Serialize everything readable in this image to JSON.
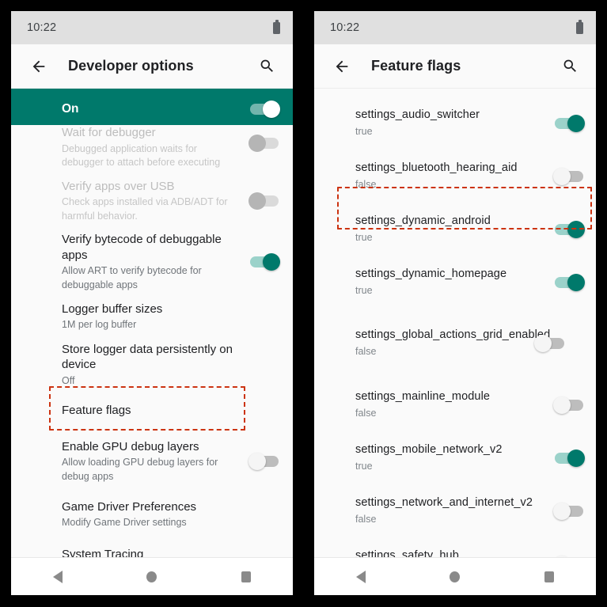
{
  "theme": {
    "teal": "#00796B",
    "highlight_red": "#CC3311",
    "status_bar_bg": "#E0E0E0",
    "app_bar_bg": "#FAFAFA",
    "page_bg": "#000000"
  },
  "left_phone": {
    "status_bar": {
      "time": "10:22",
      "battery_icon": "battery-icon"
    },
    "app_bar": {
      "back_icon": "arrow-back-icon",
      "title": "Developer options",
      "search_icon": "search-icon"
    },
    "master_switch": {
      "label": "On",
      "state": "on"
    },
    "rows": [
      {
        "title": "Wait for debugger",
        "subtitle": "Debugged application waits for debugger to attach before executing",
        "switch": "off",
        "dim": true
      },
      {
        "title": "Verify apps over USB",
        "subtitle": "Check apps installed via ADB/ADT for harmful behavior.",
        "switch": "off",
        "dim": true
      },
      {
        "title": "Verify bytecode of debuggable apps",
        "subtitle": "Allow ART to verify bytecode for debuggable apps",
        "switch": "on",
        "dim": false
      },
      {
        "title": "Logger buffer sizes",
        "subtitle": "1M per log buffer",
        "switch": "none",
        "dim": false
      },
      {
        "title": "Store logger data persistently on device",
        "subtitle": "Off",
        "switch": "none",
        "dim": false
      },
      {
        "title": "Feature flags",
        "subtitle": "",
        "switch": "none",
        "dim": false,
        "highlighted": true
      },
      {
        "title": "Enable GPU debug layers",
        "subtitle": "Allow loading GPU debug layers for debug apps",
        "switch": "off",
        "dim": false
      },
      {
        "title": "Game Driver Preferences",
        "subtitle": "Modify Game Driver settings",
        "switch": "none",
        "dim": false
      },
      {
        "title": "System Tracing",
        "subtitle": "",
        "switch": "none",
        "dim": false
      }
    ],
    "nav_bar": {
      "back_icon": "nav-back-icon",
      "home_icon": "nav-home-icon",
      "recents_icon": "nav-recents-icon"
    }
  },
  "right_phone": {
    "status_bar": {
      "time": "10:22",
      "battery_icon": "battery-icon"
    },
    "app_bar": {
      "back_icon": "arrow-back-icon",
      "title": "Feature flags",
      "search_icon": "search-icon"
    },
    "flags": [
      {
        "name": "settings_audio_switcher",
        "value": "true",
        "switch": "on"
      },
      {
        "name": "settings_bluetooth_hearing_aid",
        "value": "false",
        "switch": "off"
      },
      {
        "name": "settings_dynamic_android",
        "value": "true",
        "switch": "on",
        "highlighted": true
      },
      {
        "name": "settings_dynamic_homepage",
        "value": "true",
        "switch": "on"
      },
      {
        "name": "settings_global_actions_grid_enabled",
        "value": "false",
        "switch": "off"
      },
      {
        "name": "settings_mainline_module",
        "value": "false",
        "switch": "off"
      },
      {
        "name": "settings_mobile_network_v2",
        "value": "true",
        "switch": "on"
      },
      {
        "name": "settings_network_and_internet_v2",
        "value": "false",
        "switch": "off"
      },
      {
        "name": "settings_safety_hub",
        "value": "false",
        "switch": "off"
      }
    ],
    "nav_bar": {
      "back_icon": "nav-back-icon",
      "home_icon": "nav-home-icon",
      "recents_icon": "nav-recents-icon"
    }
  }
}
